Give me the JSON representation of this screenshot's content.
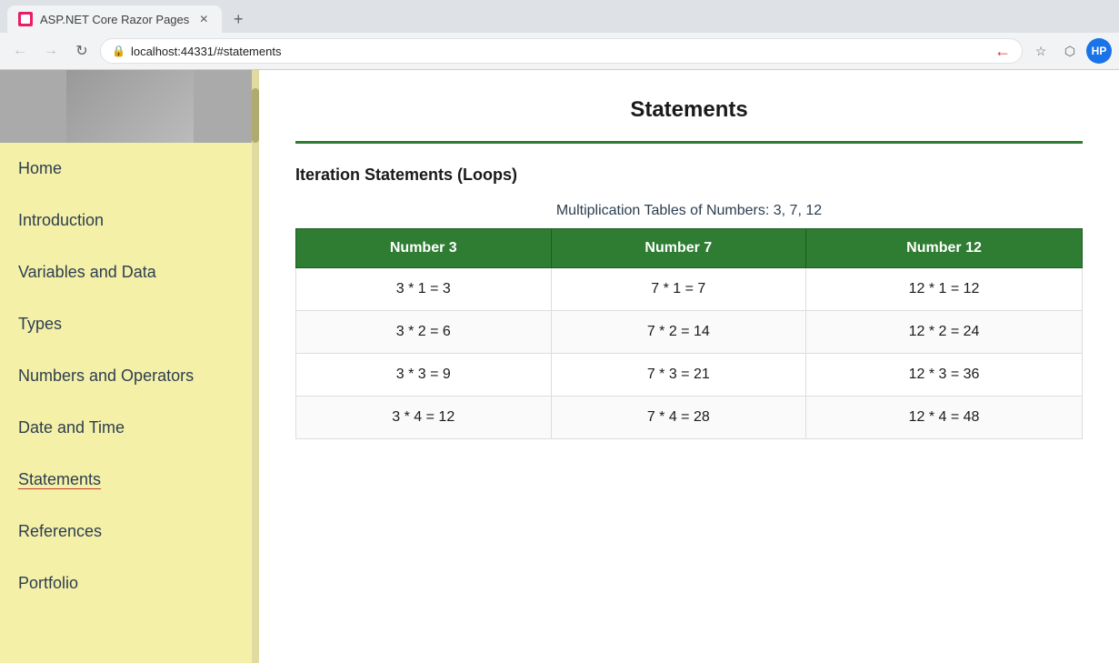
{
  "browser": {
    "tab_title": "ASP.NET Core Razor Pages",
    "url": "localhost:44331/#statements",
    "url_highlight": "#statements",
    "back_disabled": false,
    "forward_disabled": true
  },
  "sidebar": {
    "nav_items": [
      {
        "label": "Home",
        "href": "#home",
        "active": false
      },
      {
        "label": "Introduction",
        "href": "#introduction",
        "active": false
      },
      {
        "label": "Variables and Data",
        "href": "#variables",
        "active": false
      },
      {
        "label": "Types",
        "href": "#types",
        "active": false
      },
      {
        "label": "Numbers and Operators",
        "href": "#numbers",
        "active": false
      },
      {
        "label": "Date and Time",
        "href": "#datetime",
        "active": false
      },
      {
        "label": "Statements",
        "href": "#statements",
        "active": true
      },
      {
        "label": "References",
        "href": "#references",
        "active": false
      },
      {
        "label": "Portfolio",
        "href": "#portfolio",
        "active": false
      }
    ]
  },
  "main": {
    "page_title": "Statements",
    "section_heading": "Iteration Statements (Loops)",
    "table_caption": "Multiplication Tables of Numbers: 3, 7, 12",
    "table_headers": [
      "Number 3",
      "Number 7",
      "Number 12"
    ],
    "table_rows": [
      [
        "3 * 1 = 3",
        "7 * 1 = 7",
        "12 * 1 = 12"
      ],
      [
        "3 * 2 = 6",
        "7 * 2 = 14",
        "12 * 2 = 24"
      ],
      [
        "3 * 3 = 9",
        "7 * 3 = 21",
        "12 * 3 = 36"
      ],
      [
        "3 * 4 = 12",
        "7 * 4 = 28",
        "12 * 4 = 48"
      ]
    ]
  }
}
